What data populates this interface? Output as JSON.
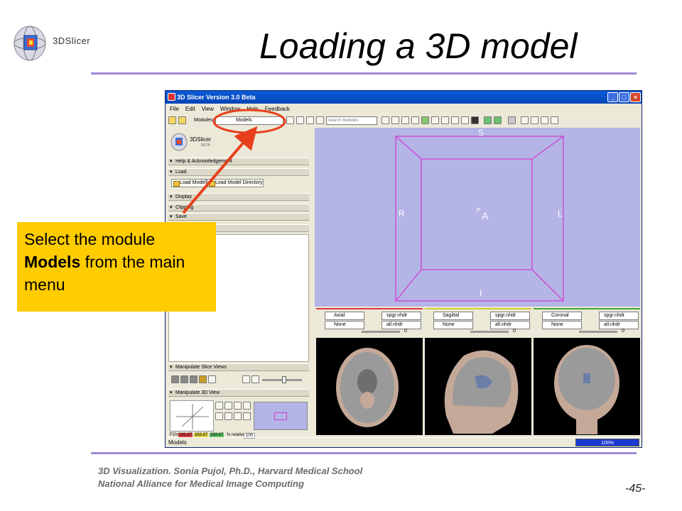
{
  "slide": {
    "title": "Loading a 3D model",
    "footer_line1": "3D Visualization. Sonia Pujol, Ph.D., Harvard Medical School",
    "footer_line2": "National Alliance for Medical Image Computing",
    "page_number": "-45-",
    "logo_text": "3DSlicer",
    "accent_color": "#a08ad8"
  },
  "callout": {
    "text_before": "Select the module ",
    "text_bold": "Models",
    "text_after": " from the main menu",
    "background": "#ffcc00",
    "arrow_color": "#e8401c"
  },
  "app": {
    "window_title": "3D Slicer Version 3.0 Beta",
    "window_buttons": {
      "minimize": "_",
      "maximize": "□",
      "close": "×"
    },
    "menu": [
      "File",
      "Edit",
      "View",
      "Window",
      "Help",
      "Feedback"
    ],
    "modules_label": "Modules:",
    "modules_value": "Models",
    "search_placeholder": "search modules",
    "brand": "3DSlicer",
    "brand_sub": "BETA",
    "sections": {
      "help": "Help & Acknowledgement",
      "load": "Load",
      "display": "Display",
      "clipping": "Clipping",
      "save": "Save",
      "manipulate_slice": "Manipulate Slice Views",
      "manipulate_3d": "Manipulate 3D View"
    },
    "buttons": {
      "load_model": "Load Model",
      "load_model_dir": "Load Model Directory"
    },
    "view3d_labels": {
      "superior": "S",
      "inferior": "I",
      "right": "R",
      "left": "L",
      "anterior": "A",
      "posterior": "P"
    },
    "slice_rows": [
      {
        "orientation": "Axial",
        "bg": "spgr.nhdr",
        "lbl": "None",
        "fg": "all.nhdr",
        "offset": "0",
        "color": "#d83a3a"
      },
      {
        "orientation": "Sagittal",
        "bg": "spgr.nhdr",
        "lbl": "None",
        "fg": "all.nhdr",
        "offset": "0",
        "color": "#d8c83a"
      },
      {
        "orientation": "Coronal",
        "bg": "spgr.nhdr",
        "lbl": "None",
        "fg": "all.nhdr",
        "offset": "0",
        "color": "#3aa83a"
      }
    ],
    "fov": {
      "label": "FOV:",
      "x": "263.67",
      "y": "263.67",
      "z": "263.67",
      "relative_label": "% relative:",
      "relative_value": "100"
    },
    "status_text": "Models",
    "progress_text": "100%"
  }
}
